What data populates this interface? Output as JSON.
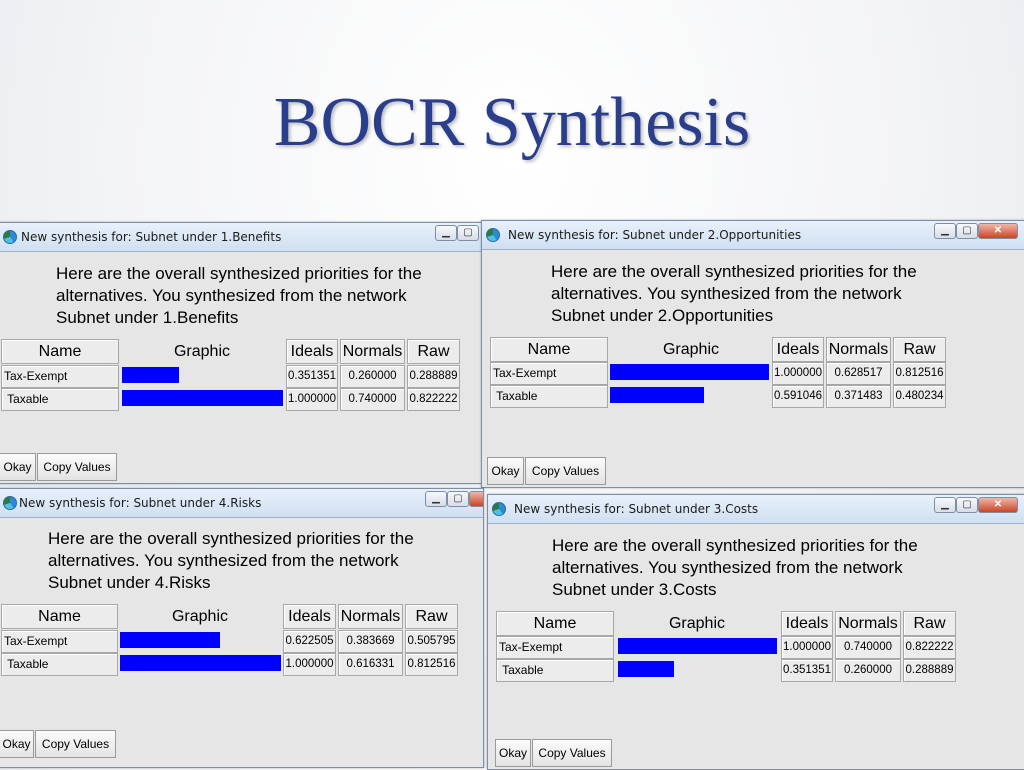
{
  "slide": {
    "title": "BOCR Synthesis"
  },
  "windows": {
    "benefits": {
      "title": "New synthesis for: Subnet under 1.Benefits",
      "message": [
        "Here are the overall synthesized priorities for the",
        "alternatives.  You synthesized from the network",
        "Subnet under 1.Benefits"
      ],
      "headers": {
        "name": "Name",
        "graphic": "Graphic",
        "ideals": "Ideals",
        "normals": "Normals",
        "raw": "Raw"
      },
      "rows": [
        {
          "name": "Tax-Exempt",
          "ideal": "0.351351",
          "normal": "0.260000",
          "raw": "0.288889",
          "bar_fraction": 0.351351
        },
        {
          "name": " Taxable",
          "ideal": "1.000000",
          "normal": "0.740000",
          "raw": "0.822222",
          "bar_fraction": 1.0
        }
      ],
      "buttons": {
        "okay": "Okay",
        "copy": "Copy Values"
      }
    },
    "opportunities": {
      "title": "New synthesis for: Subnet under 2.Opportunities",
      "message": [
        "Here are the overall synthesized priorities for the",
        "alternatives.  You synthesized from the network",
        "Subnet under 2.Opportunities"
      ],
      "headers": {
        "name": "Name",
        "graphic": "Graphic",
        "ideals": "Ideals",
        "normals": "Normals",
        "raw": "Raw"
      },
      "rows": [
        {
          "name": "Tax-Exempt",
          "ideal": "1.000000",
          "normal": "0.628517",
          "raw": "0.812516",
          "bar_fraction": 1.0
        },
        {
          "name": " Taxable",
          "ideal": "0.591046",
          "normal": "0.371483",
          "raw": "0.480234",
          "bar_fraction": 0.591046
        }
      ],
      "buttons": {
        "okay": "Okay",
        "copy": "Copy Values"
      }
    },
    "risks": {
      "title": "New synthesis for: Subnet under 4.Risks",
      "message": [
        "Here are the overall synthesized priorities for the",
        "alternatives.  You synthesized from the network",
        "Subnet under 4.Risks"
      ],
      "headers": {
        "name": "Name",
        "graphic": "Graphic",
        "ideals": "Ideals",
        "normals": "Normals",
        "raw": "Raw"
      },
      "rows": [
        {
          "name": "Tax-Exempt",
          "ideal": "0.622505",
          "normal": "0.383669",
          "raw": "0.505795",
          "bar_fraction": 0.622505
        },
        {
          "name": " Taxable",
          "ideal": "1.000000",
          "normal": "0.616331",
          "raw": "0.812516",
          "bar_fraction": 1.0
        }
      ],
      "buttons": {
        "okay": "Okay",
        "copy": "Copy Values"
      }
    },
    "costs": {
      "title": "New synthesis for: Subnet under 3.Costs",
      "message": [
        "Here are the overall synthesized priorities for the",
        "alternatives.  You synthesized from the network",
        "Subnet under 3.Costs"
      ],
      "headers": {
        "name": "Name",
        "graphic": "Graphic",
        "ideals": "Ideals",
        "normals": "Normals",
        "raw": "Raw"
      },
      "rows": [
        {
          "name": "Tax-Exempt",
          "ideal": "1.000000",
          "normal": "0.740000",
          "raw": "0.822222",
          "bar_fraction": 1.0
        },
        {
          "name": " Taxable",
          "ideal": "0.351351",
          "normal": "0.260000",
          "raw": "0.288889",
          "bar_fraction": 0.351351
        }
      ],
      "buttons": {
        "okay": "Okay",
        "copy": "Copy Values"
      }
    }
  }
}
